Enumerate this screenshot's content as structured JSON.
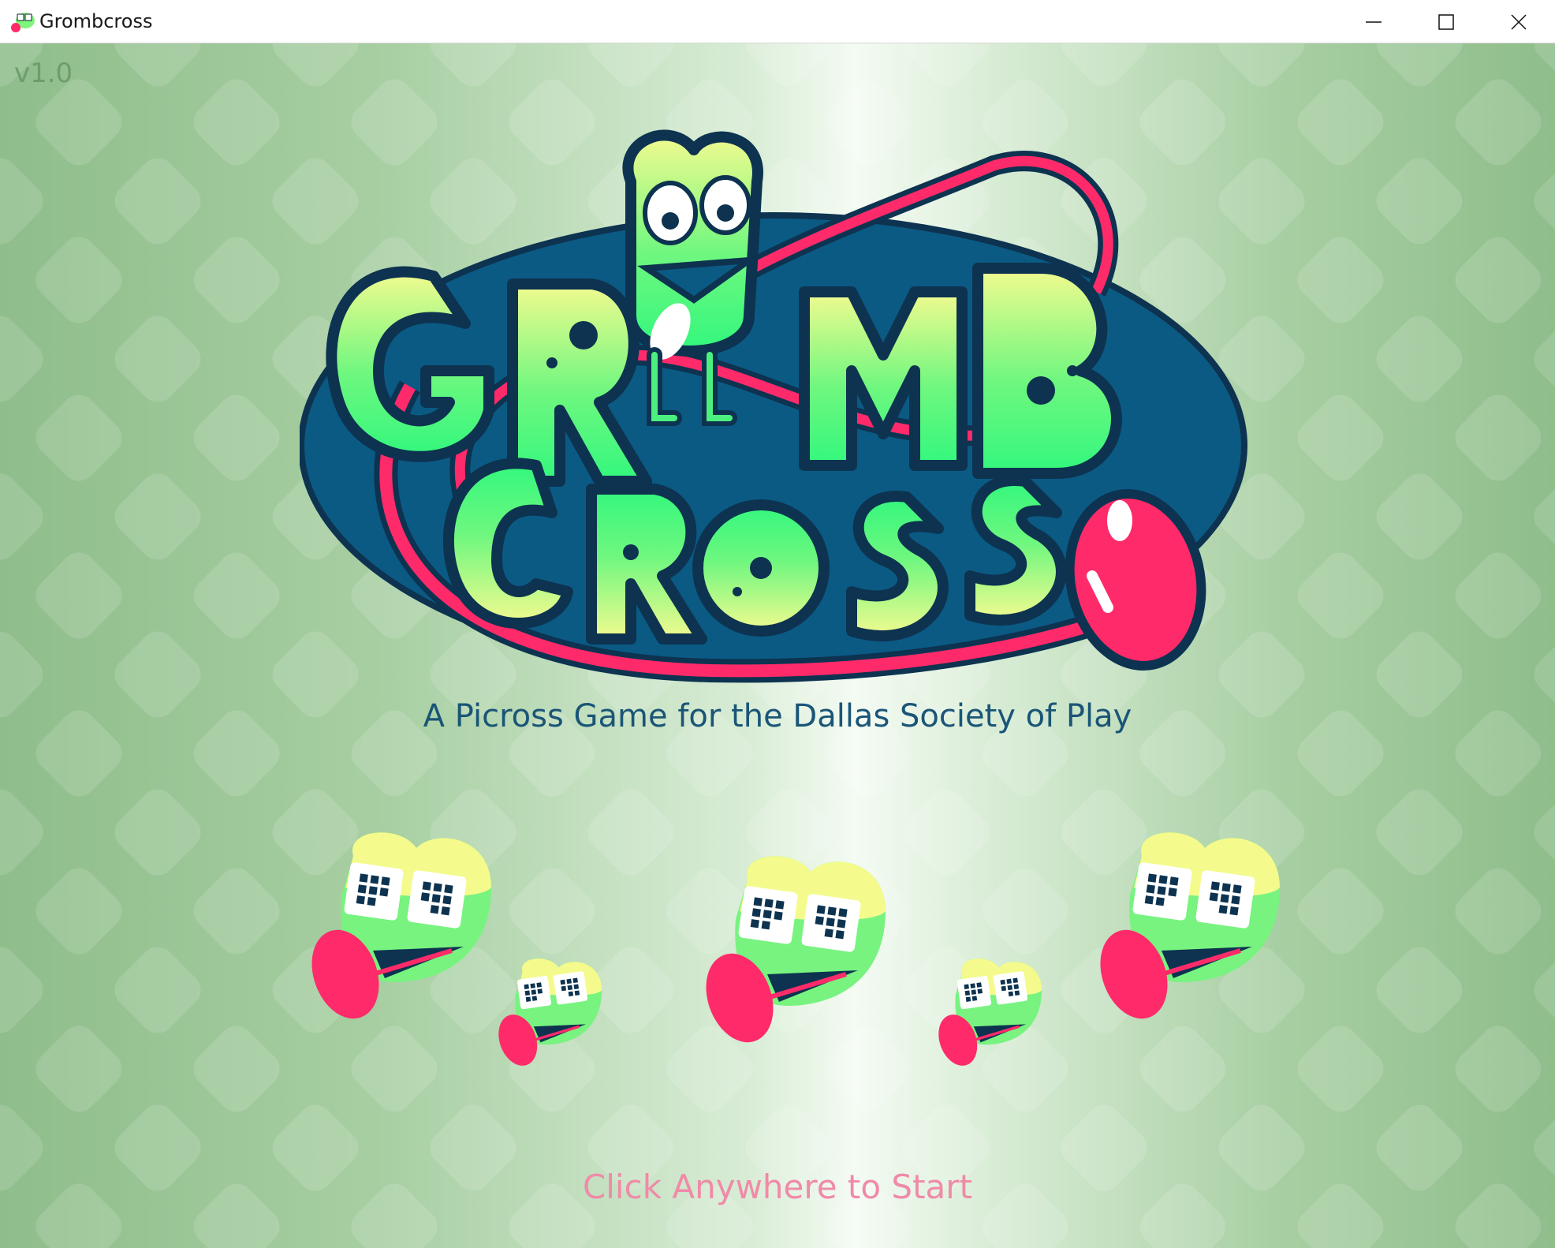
{
  "window": {
    "title": "Grombcross",
    "app_icon": "grombcross-app-icon",
    "controls": {
      "minimize": "minimize-icon",
      "maximize": "maximize-icon",
      "close": "close-icon"
    }
  },
  "game": {
    "version": "v1.0",
    "logo_text": "GROMB CROSS",
    "tagline": "A Picross Game for the Dallas Society of Play",
    "start_prompt": "Click Anywhere to Start",
    "colors": {
      "logo_backdrop": "#0b5a84",
      "logo_outline": "#0d3350",
      "letter_top": "#f2fb8f",
      "letter_bottom": "#33f77d",
      "tongue": "#ff2a6a",
      "tagline": "#1a5577",
      "start_prompt": "#f08aa8"
    }
  }
}
